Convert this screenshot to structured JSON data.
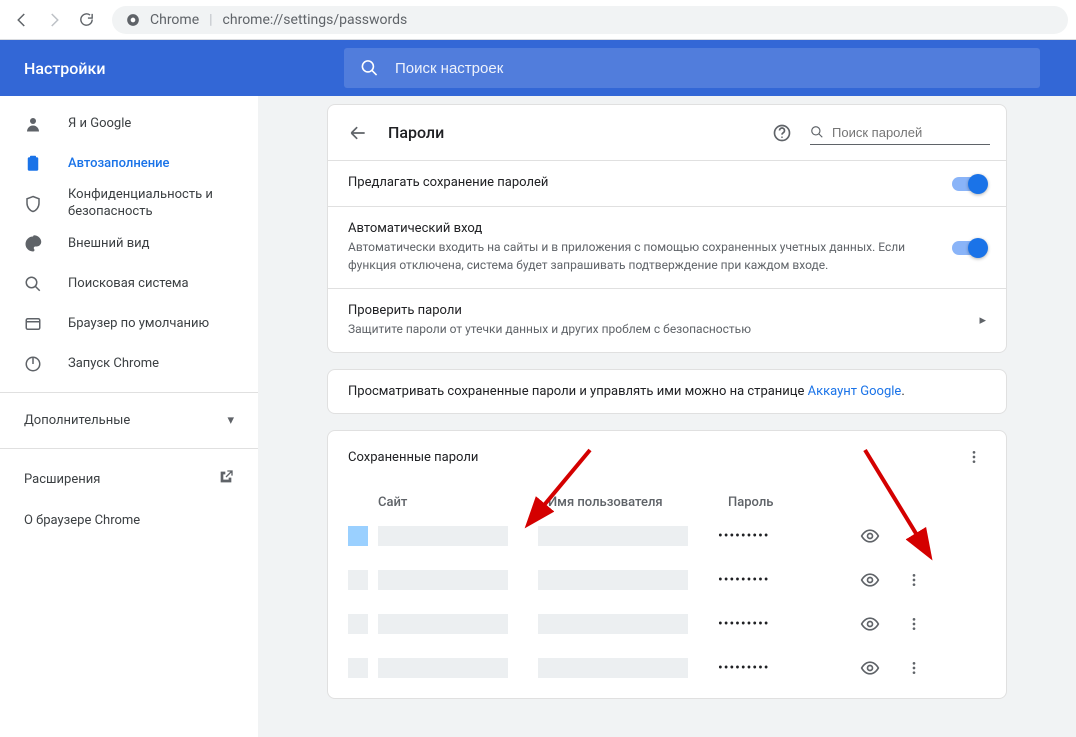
{
  "browser": {
    "product": "Chrome",
    "url": "chrome://settings/passwords"
  },
  "header": {
    "title": "Настройки",
    "search_placeholder": "Поиск настроек"
  },
  "sidebar": {
    "items": [
      {
        "icon": "person",
        "label": "Я и Google"
      },
      {
        "icon": "clipboard",
        "label": "Автозаполнение",
        "active": true
      },
      {
        "icon": "shield",
        "label": "Конфиденциальность и безопасность"
      },
      {
        "icon": "palette",
        "label": "Внешний вид"
      },
      {
        "icon": "search",
        "label": "Поисковая система"
      },
      {
        "icon": "browser",
        "label": "Браузер по умолчанию"
      },
      {
        "icon": "power",
        "label": "Запуск Chrome"
      }
    ],
    "more": "Дополнительные",
    "extensions": "Расширения",
    "about": "О браузере Chrome"
  },
  "page": {
    "title": "Пароли",
    "local_search_placeholder": "Поиск паролей",
    "offer_save": {
      "label": "Предлагать сохранение паролей"
    },
    "auto_signin": {
      "label": "Автоматический вход",
      "desc": "Автоматически входить на сайты и в приложения с помощью сохраненных учетных данных. Если функция отключена, система будет запрашивать подтверждение при каждом входе."
    },
    "check": {
      "label": "Проверить пароли",
      "desc": "Защитите пароли от утечки данных и других проблем с безопасностью"
    },
    "account_hint_pre": "Просматривать сохраненные пароли и управлять ими можно на странице ",
    "account_hint_link": "Аккаунт Google",
    "saved": {
      "title": "Сохраненные пароли",
      "col_site": "Сайт",
      "col_user": "Имя пользователя",
      "col_pass": "Пароль",
      "rows": [
        {
          "mask": "•••••••••"
        },
        {
          "mask": "•••••••••"
        },
        {
          "mask": "•••••••••"
        },
        {
          "mask": "•••••••••"
        }
      ]
    }
  }
}
